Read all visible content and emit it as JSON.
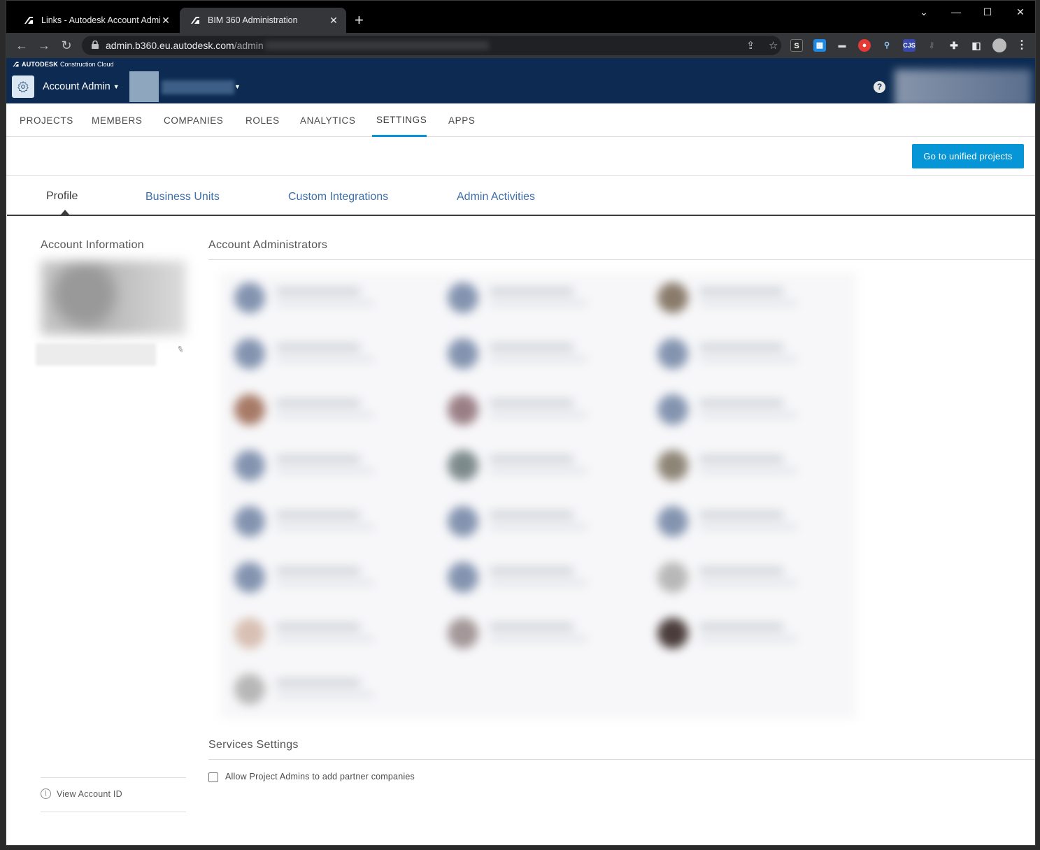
{
  "browser": {
    "tabs": [
      {
        "title": "Links - Autodesk Account Admin",
        "active": false
      },
      {
        "title": "BIM 360 Administration",
        "active": true
      }
    ],
    "new_tab": "+",
    "url_host": "admin.b360.eu.autodesk.com",
    "url_path": "/admin"
  },
  "app": {
    "brand_bold": "AUTODESK",
    "brand_rest": "Construction Cloud",
    "module_label": "Account Admin",
    "help_label": "?"
  },
  "main_nav": {
    "items": [
      "PROJECTS",
      "MEMBERS",
      "COMPANIES",
      "ROLES",
      "ANALYTICS",
      "SETTINGS",
      "APPS"
    ],
    "active": "SETTINGS"
  },
  "actions": {
    "unified_projects_label": "Go to unified projects"
  },
  "sub_tabs": {
    "items": [
      "Profile",
      "Business Units",
      "Custom Integrations",
      "Admin Activities"
    ],
    "active": "Profile"
  },
  "profile": {
    "account_info_title": "Account Information",
    "view_account_id": "View Account ID",
    "admins_title": "Account Administrators",
    "services_title": "Services Settings",
    "allow_partner_label": "Allow Project Admins to add partner companies",
    "allow_partner_checked": false
  },
  "colors": {
    "header_bg": "#0d2b52",
    "accent": "#0696d7",
    "link": "#3d6fa8"
  }
}
